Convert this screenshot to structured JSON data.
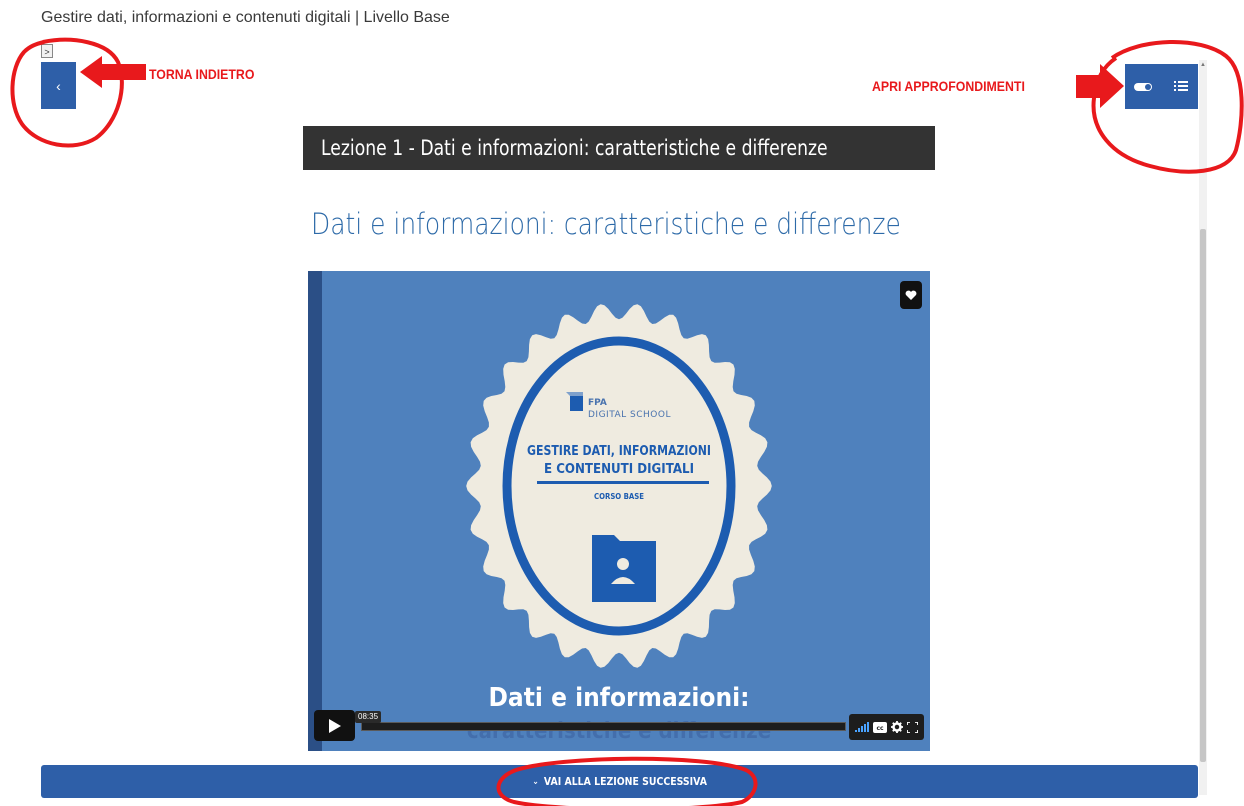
{
  "course_title": "Gestire dati, informazioni e contenuti digitali | Livello Base",
  "mini_toggle": ">",
  "back_button": "‹",
  "annotations": {
    "back_label": "TORNA INDIETRO",
    "open_label": "APRI APPROFONDIMENTI"
  },
  "lesson_bar": {
    "label": "Lezione 1 - Dati e informazioni: caratteristiche e differenze"
  },
  "heading": "Dati e informazioni: caratteristiche e differenze",
  "video": {
    "badge": {
      "brand_top": "FPA",
      "brand_bottom": "DIGITAL SCHOOL",
      "title_line1": "GESTIRE DATI, INFORMAZIONI",
      "title_line2": "E CONTENUTI DIGITALI",
      "subtitle": "CORSO BASE"
    },
    "caption_line1": "Dati e informazioni:",
    "caption_line2": "caratteristiche e differenze",
    "time": "08:35"
  },
  "next_button": {
    "chevron": "⌄",
    "label": "VAI ALLA LEZIONE SUCCESSIVA"
  },
  "colors": {
    "primary_blue": "#2e5fa8",
    "annotation_red": "#e8191c",
    "video_bg": "#4f81bd",
    "badge_cream": "#efebe0",
    "heading_blue": "#2d6aa8"
  },
  "icons": [
    "chevron-left-icon",
    "toggle-icon",
    "list-icon",
    "heart-icon",
    "play-icon",
    "volume-icon",
    "captions-icon",
    "settings-icon",
    "fullscreen-icon",
    "chevron-down-icon",
    "folder-user-icon"
  ]
}
